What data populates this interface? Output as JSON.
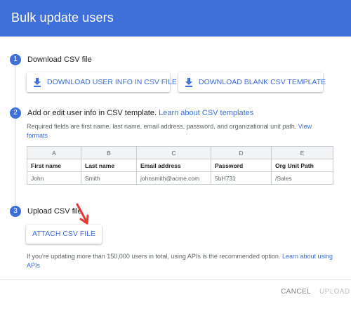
{
  "dialog": {
    "title": "Bulk update users"
  },
  "steps": [
    {
      "number": "1",
      "title": "Download CSV file",
      "buttons": [
        {
          "label": "DOWNLOAD USER INFO IN CSV FILE",
          "icon": "download-icon"
        },
        {
          "label": "DOWNLOAD BLANK CSV TEMPLATE",
          "icon": "download-icon"
        }
      ]
    },
    {
      "number": "2",
      "title": "Add or edit user info in CSV template.",
      "link": "Learn about CSV templates",
      "helper_line1": "Required fields are first name, last name, email address, password, and organizational unit path.",
      "helper_link_part1": "View",
      "helper_link_part2": "formats",
      "table": {
        "column_letters": [
          "A",
          "B",
          "C",
          "D",
          "E"
        ],
        "headers": [
          "First name",
          "Last name",
          "Email address",
          "Password",
          "Org Unit Path"
        ],
        "sample_row": [
          "John",
          "Smith",
          "johnsmith@acme.com",
          "5bH731",
          "/Sales"
        ]
      }
    },
    {
      "number": "3",
      "title": "Upload CSV file",
      "button_label": "ATTACH CSV FILE",
      "annotation": "red-arrow",
      "note_line1": "If you're updating more than 150,000 users in total, using APIs is the recommended option.",
      "note_link_part1": "Learn about using",
      "note_link_part2": "APIs"
    }
  ],
  "footer": {
    "cancel_label": "CANCEL",
    "upload_label": "UPLOAD"
  },
  "colors": {
    "accent": "#3f6fd8",
    "annotation_arrow": "#e53935",
    "disabled_text": "#bdc1c6",
    "secondary_text": "#80868b"
  }
}
